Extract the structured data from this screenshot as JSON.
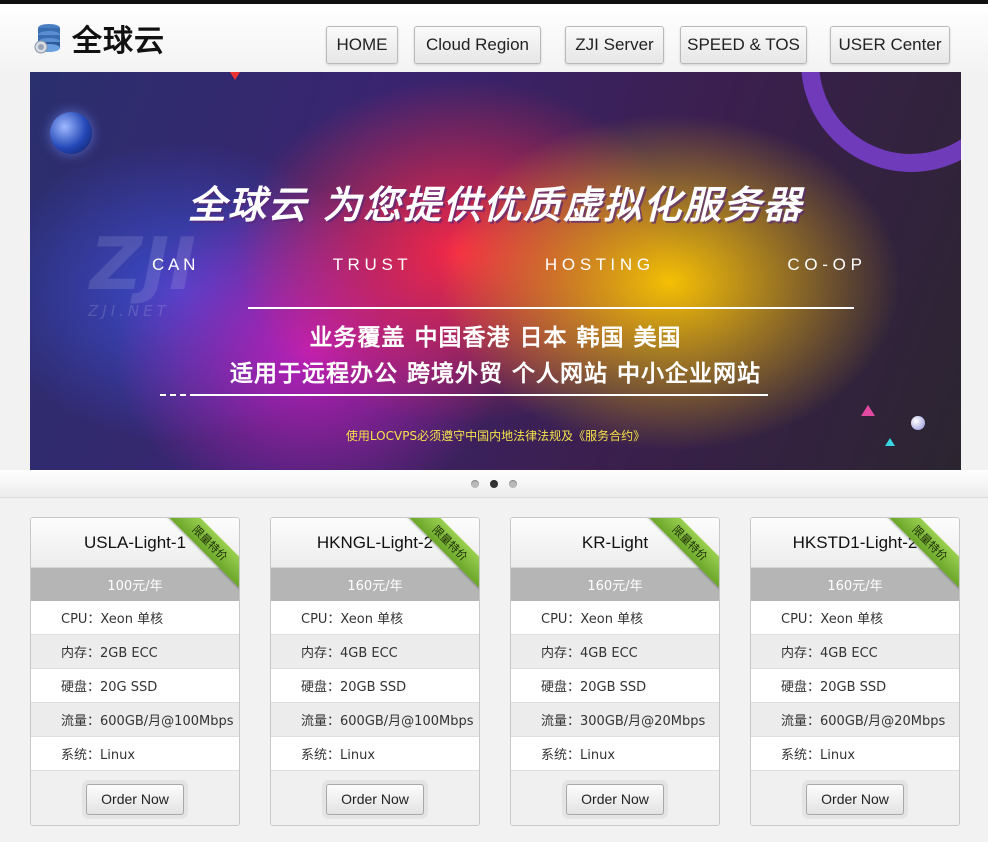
{
  "header": {
    "logo_text": "全球云",
    "logo_icon": "database-icon",
    "nav": [
      {
        "label": "HOME"
      },
      {
        "label": "Cloud Region"
      },
      {
        "label": "ZJI Server"
      },
      {
        "label": "SPEED & TOS"
      },
      {
        "label": "USER Center"
      }
    ]
  },
  "banner": {
    "title": "全球云 为您提供优质虚拟化服务器",
    "tagline": [
      "C A N",
      "T R U S T",
      "H O S T I N G",
      "C O - O P"
    ],
    "watermark": "ZJI",
    "watermark_sub": "ZJI.NET",
    "coverage": "业务覆盖 中国香港 日本 韩国 美国",
    "usage": "适用于远程办公 跨境外贸 个人网站 中小企业网站",
    "legal": "使用LOCVPS必须遵守中国内地法律法规及《服务合约》"
  },
  "slider": {
    "dots": 3,
    "active_index": 1
  },
  "plans": [
    {
      "name": "USLA-Light-1",
      "ribbon": "限量特价",
      "price": "100元/年",
      "specs": [
        "CPU：Xeon 单核",
        "内存：2GB ECC",
        "硬盘：20G SSD",
        "流量：600GB/月@100Mbps",
        "系统：Linux"
      ],
      "button": "Order Now"
    },
    {
      "name": "HKNGL-Light-2",
      "ribbon": "限量特价",
      "price": "160元/年",
      "specs": [
        "CPU：Xeon 单核",
        "内存：4GB ECC",
        "硬盘：20GB SSD",
        "流量：600GB/月@100Mbps",
        "系统：Linux"
      ],
      "button": "Order Now"
    },
    {
      "name": "KR-Light",
      "ribbon": "限量特价",
      "price": "160元/年",
      "specs": [
        "CPU：Xeon 单核",
        "内存：4GB ECC",
        "硬盘：20GB SSD",
        "流量：300GB/月@20Mbps",
        "系统：Linux"
      ],
      "button": "Order Now"
    },
    {
      "name": "HKSTD1-Light-2",
      "ribbon": "限量特价",
      "price": "160元/年",
      "specs": [
        "CPU：Xeon 单核",
        "内存：4GB ECC",
        "硬盘：20GB SSD",
        "流量：600GB/月@20Mbps",
        "系统：Linux"
      ],
      "button": "Order Now"
    }
  ]
}
